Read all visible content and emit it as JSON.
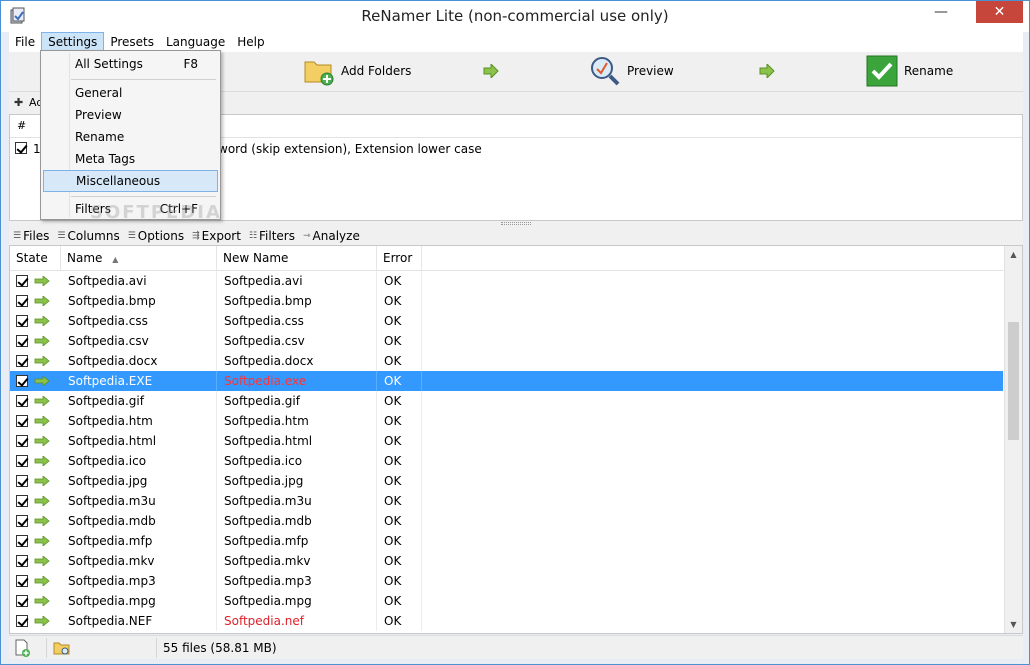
{
  "window": {
    "title": "ReNamer Lite (non-commercial use only)",
    "minimize_glyph": "—",
    "close_glyph": "✕"
  },
  "menubar": [
    "File",
    "Settings",
    "Presets",
    "Language",
    "Help"
  ],
  "toolbar": {
    "add_folders": "Add Folders",
    "preview": "Preview",
    "rename": "Rename"
  },
  "rules": {
    "add_label": "Ad",
    "col_num": "#",
    "row_num": "1",
    "row_text": "word (skip extension), Extension lower case"
  },
  "files_toolbar": [
    "Files",
    "Columns",
    "Options",
    "Export",
    "Filters",
    "Analyze"
  ],
  "files_table": {
    "columns": {
      "state": "State",
      "name": "Name",
      "new_name": "New Name",
      "error": "Error"
    },
    "rows": [
      {
        "name": "Softpedia.avi",
        "new_name": "Softpedia.avi",
        "error": "OK",
        "changed": false,
        "selected": false
      },
      {
        "name": "Softpedia.bmp",
        "new_name": "Softpedia.bmp",
        "error": "OK",
        "changed": false,
        "selected": false
      },
      {
        "name": "Softpedia.css",
        "new_name": "Softpedia.css",
        "error": "OK",
        "changed": false,
        "selected": false
      },
      {
        "name": "Softpedia.csv",
        "new_name": "Softpedia.csv",
        "error": "OK",
        "changed": false,
        "selected": false
      },
      {
        "name": "Softpedia.docx",
        "new_name": "Softpedia.docx",
        "error": "OK",
        "changed": false,
        "selected": false
      },
      {
        "name": "Softpedia.EXE",
        "new_name": "Softpedia.exe",
        "error": "OK",
        "changed": true,
        "selected": true
      },
      {
        "name": "Softpedia.gif",
        "new_name": "Softpedia.gif",
        "error": "OK",
        "changed": false,
        "selected": false
      },
      {
        "name": "Softpedia.htm",
        "new_name": "Softpedia.htm",
        "error": "OK",
        "changed": false,
        "selected": false
      },
      {
        "name": "Softpedia.html",
        "new_name": "Softpedia.html",
        "error": "OK",
        "changed": false,
        "selected": false
      },
      {
        "name": "Softpedia.ico",
        "new_name": "Softpedia.ico",
        "error": "OK",
        "changed": false,
        "selected": false
      },
      {
        "name": "Softpedia.jpg",
        "new_name": "Softpedia.jpg",
        "error": "OK",
        "changed": false,
        "selected": false
      },
      {
        "name": "Softpedia.m3u",
        "new_name": "Softpedia.m3u",
        "error": "OK",
        "changed": false,
        "selected": false
      },
      {
        "name": "Softpedia.mdb",
        "new_name": "Softpedia.mdb",
        "error": "OK",
        "changed": false,
        "selected": false
      },
      {
        "name": "Softpedia.mfp",
        "new_name": "Softpedia.mfp",
        "error": "OK",
        "changed": false,
        "selected": false
      },
      {
        "name": "Softpedia.mkv",
        "new_name": "Softpedia.mkv",
        "error": "OK",
        "changed": false,
        "selected": false
      },
      {
        "name": "Softpedia.mp3",
        "new_name": "Softpedia.mp3",
        "error": "OK",
        "changed": false,
        "selected": false
      },
      {
        "name": "Softpedia.mpg",
        "new_name": "Softpedia.mpg",
        "error": "OK",
        "changed": false,
        "selected": false
      },
      {
        "name": "Softpedia.NEF",
        "new_name": "Softpedia.nef",
        "error": "OK",
        "changed": true,
        "selected": false
      }
    ]
  },
  "statusbar": {
    "file_count": "55 files (58.81 MB)"
  },
  "settings_menu": {
    "items": [
      {
        "label": "All Settings",
        "shortcut": "F8"
      },
      {
        "label": "General",
        "shortcut": ""
      },
      {
        "label": "Preview",
        "shortcut": ""
      },
      {
        "label": "Rename",
        "shortcut": ""
      },
      {
        "label": "Meta Tags",
        "shortcut": ""
      },
      {
        "label": "Miscellaneous",
        "shortcut": ""
      },
      {
        "label": "Filters",
        "shortcut": "Ctrl+F"
      }
    ],
    "highlighted": "Miscellaneous"
  },
  "watermark": "SOFTPEDIA",
  "colors": {
    "selection": "#3399ff",
    "changed_text": "#e0202a",
    "accent_green": "#3ba53b"
  }
}
